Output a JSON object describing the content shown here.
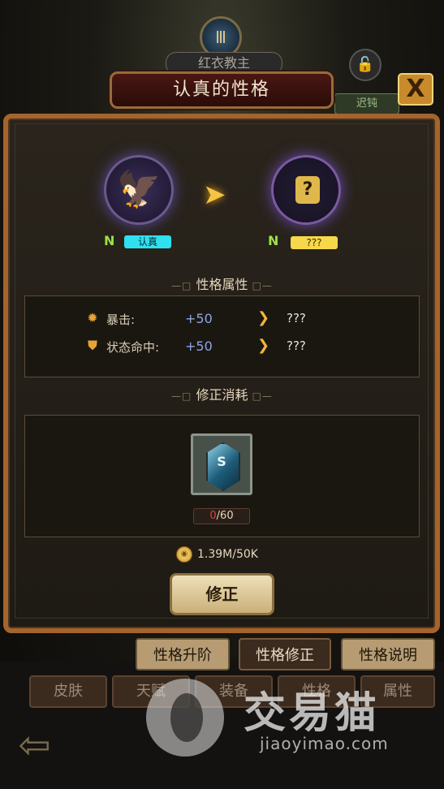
{
  "header": {
    "emblem": "Ⅲ",
    "character_name": "红衣教主",
    "lock_icon": "lock-open-icon",
    "state_tag": "迟钝",
    "title": "认真的性格",
    "close_label": "X"
  },
  "transform": {
    "current": {
      "rank": "N",
      "name": "认真",
      "icon": "eagle-icon"
    },
    "target": {
      "rank": "N",
      "name": "???",
      "icon": "question-icon"
    }
  },
  "sections": {
    "attributes_title": "性格属性",
    "cost_title": "修正消耗",
    "deco_left": "—□",
    "deco_right": "□—"
  },
  "attributes": [
    {
      "icon": "crit-icon",
      "label": "暴击:",
      "value": "+50",
      "new_value": "???"
    },
    {
      "icon": "shield-icon",
      "label": "状态命中:",
      "value": "+50",
      "new_value": "???"
    }
  ],
  "cost": {
    "item_letter": "S",
    "owned": "0",
    "required": "/60",
    "gold": "1.39M/50K"
  },
  "fix_button": "修正",
  "tabs": [
    {
      "label": "性格升阶",
      "active": false
    },
    {
      "label": "性格修正",
      "active": true
    },
    {
      "label": "性格说明",
      "active": false
    }
  ],
  "nav": [
    "皮肤",
    "天赋",
    "装备",
    "性格",
    "属性"
  ],
  "watermark": {
    "text": "交易猫",
    "sub": "jiaoyimao.com"
  },
  "colors": {
    "panel_border": "#a5642b",
    "rank": "#9ee04a",
    "attr_value": "#8fa3e6",
    "count_red": "#e0413b"
  }
}
